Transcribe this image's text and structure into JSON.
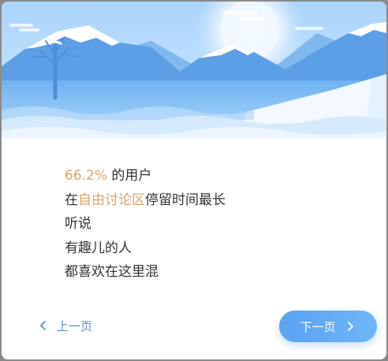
{
  "guide": {
    "lines": [
      {
        "parts": [
          {
            "text": "66.2%",
            "highlight": true
          },
          {
            "text": " 的用户",
            "highlight": false
          }
        ]
      },
      {
        "parts": [
          {
            "text": "在",
            "highlight": false
          },
          {
            "text": "自由讨论区",
            "highlight": true
          },
          {
            "text": "停留时间最长",
            "highlight": false
          }
        ]
      },
      {
        "parts": [
          {
            "text": "听说",
            "highlight": false
          }
        ]
      },
      {
        "parts": [
          {
            "text": "有趣儿的人",
            "highlight": false
          }
        ]
      },
      {
        "parts": [
          {
            "text": "都喜欢在这里混",
            "highlight": false
          }
        ]
      }
    ]
  },
  "nav": {
    "prev_label": "上一页",
    "next_label": "下一页",
    "prev_icon": "chevron-left-icon",
    "next_icon": "chevron-right-icon"
  },
  "colors": {
    "highlight": "#d9a66e",
    "text": "#333333",
    "link": "#5a92c8",
    "button": "#5aa2f3"
  }
}
